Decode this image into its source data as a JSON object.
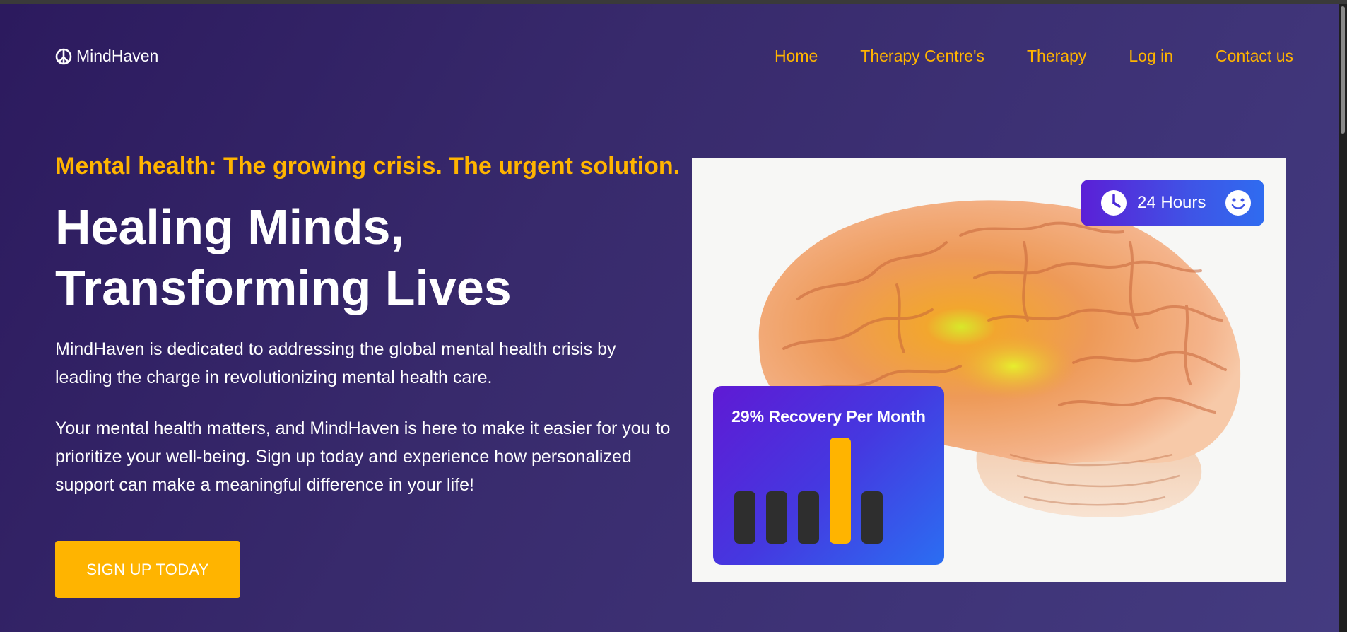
{
  "brand": {
    "name": "MindHaven",
    "icon": "peace-icon"
  },
  "nav": {
    "items": [
      "Home",
      "Therapy Centre's",
      "Therapy",
      "Log in",
      "Contact us"
    ]
  },
  "hero": {
    "tagline": "Mental health: The growing crisis. The urgent solution.",
    "headline_line1": "Healing Minds,",
    "headline_line2": "Transforming Lives",
    "paragraph1": "MindHaven is dedicated to addressing the global mental health crisis by leading the charge in revolutionizing mental health care.",
    "paragraph2": "Your mental health matters, and MindHaven is here to make it easier for you to prioritize your well-being. Sign up today and experience how personalized support can make a meaningful difference in your life!",
    "cta_label": "SIGN UP TODAY"
  },
  "image": {
    "subject": "brain-illustration"
  },
  "hours_card": {
    "label": "24 Hours",
    "icons": [
      "clock-icon",
      "smiley-icon"
    ]
  },
  "recovery_card": {
    "title": "29% Recovery Per Month",
    "bar_levels": [
      0.49,
      0.49,
      0.49,
      1.0,
      0.49
    ],
    "highlight_index": 3
  },
  "colors": {
    "accent": "#ffb400",
    "background_start": "#2c1a5e",
    "background_end": "#443b80",
    "card_gradient_start": "#5f1ad4",
    "card_gradient_end": "#2b6ef2",
    "bar_default": "#2e2e2e",
    "text": "#ffffff"
  }
}
